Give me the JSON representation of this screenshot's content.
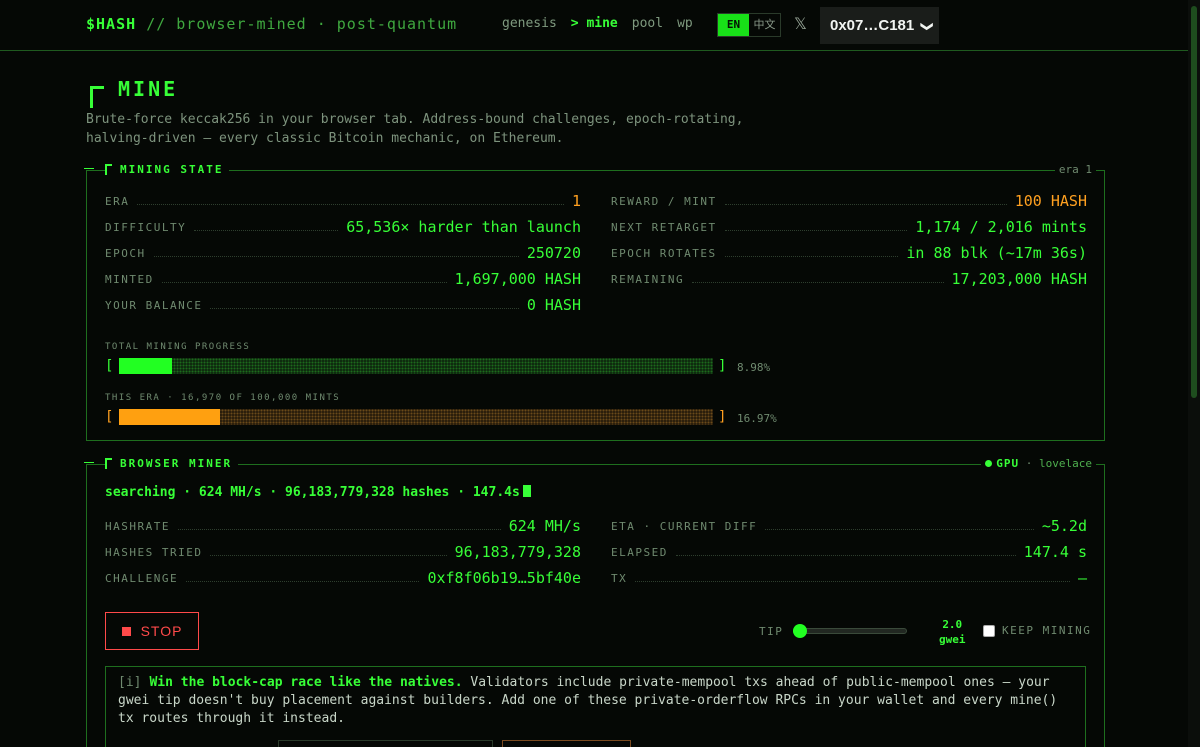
{
  "header": {
    "brand_ticker": "$HASH",
    "brand_tagline": "// browser-mined · post-quantum",
    "nav": [
      {
        "label": "genesis"
      },
      {
        "label": "> mine"
      },
      {
        "label": "pool"
      },
      {
        "label": "wp"
      }
    ],
    "lang_en": "EN",
    "lang_zh": "中文",
    "x_icon": "𝕏",
    "wallet": "0x07…C181",
    "wallet_chevron": "❯"
  },
  "page": {
    "title": "MINE",
    "intro": "Brute-force keccak256 in your browser tab. Address-bound challenges, epoch-rotating, halving-driven — every classic Bitcoin mechanic, on Ethereum."
  },
  "mining_state": {
    "heading": "MINING STATE",
    "era_tag": "era 1",
    "left": [
      {
        "key": "ERA",
        "value": "1",
        "orange": true
      },
      {
        "key": "DIFFICULTY",
        "value": "65,536× harder than launch"
      },
      {
        "key": "EPOCH",
        "value": "250720"
      },
      {
        "key": "MINTED",
        "value": "1,697,000 HASH"
      },
      {
        "key": "YOUR BALANCE",
        "value": "0 HASH"
      }
    ],
    "right": [
      {
        "key": "REWARD / MINT",
        "value": "100 HASH",
        "orange": true
      },
      {
        "key": "NEXT RETARGET",
        "value": "1,174 / 2,016 mints"
      },
      {
        "key": "EPOCH ROTATES",
        "value": "in 88 blk (~17m 36s)"
      },
      {
        "key": "REMAINING",
        "value": "17,203,000 HASH"
      }
    ],
    "total_label": "TOTAL MINING PROGRESS",
    "total_pct": "8.98%",
    "total_fraction": 0.0898,
    "era_label": "THIS ERA · 16,970 OF 100,000 MINTS",
    "era_pct": "16.97%",
    "era_fraction": 0.1697,
    "bracket_open": "[",
    "bracket_close": "]"
  },
  "miner": {
    "heading": "BROWSER MINER",
    "gpu_label": "GPU",
    "gpu_sep": "·",
    "gpu_name": "lovelace",
    "status": "searching · 624 MH/s · 96,183,779,328 hashes · 147.4s",
    "left": [
      {
        "key": "HASHRATE",
        "value": "624 MH/s"
      },
      {
        "key": "HASHES TRIED",
        "value": "96,183,779,328"
      },
      {
        "key": "CHALLENGE",
        "value": "0xf8f06b19…5bf40e"
      }
    ],
    "right": [
      {
        "key": "ETA · CURRENT DIFF",
        "value": "~5.2d"
      },
      {
        "key": "ELAPSED",
        "value": "147.4 s"
      },
      {
        "key": "TX",
        "value": "—"
      }
    ],
    "stop_label": "STOP",
    "tip_label": "TIP",
    "tip_value": "2.0",
    "tip_unit": "gwei",
    "tip_fraction": 0.0,
    "keep_label": "KEEP MINING",
    "keep_checked": false,
    "info_tag": "[i]",
    "info_highlight": "Win the block-cap race like the natives.",
    "info_text": " Validators include private-mempool txs ahead of public-mempool ones — your gwei tip doesn't buy placement against builders. Add one of these private-orderflow RPCs in your wallet and every mine() tx routes through it instead."
  },
  "colors": {
    "accent": "#37ff37",
    "orange": "#ffa020",
    "stop_red": "#ff4a4a",
    "background": "#050805"
  }
}
